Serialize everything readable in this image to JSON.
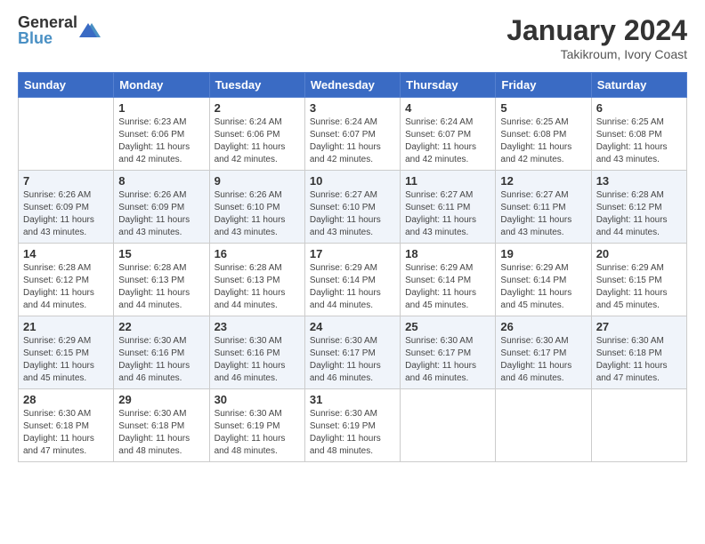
{
  "logo": {
    "general": "General",
    "blue": "Blue"
  },
  "header": {
    "month": "January 2024",
    "location": "Takikroum, Ivory Coast"
  },
  "days_of_week": [
    "Sunday",
    "Monday",
    "Tuesday",
    "Wednesday",
    "Thursday",
    "Friday",
    "Saturday"
  ],
  "weeks": [
    [
      {
        "day": "",
        "info": ""
      },
      {
        "day": "1",
        "info": "Sunrise: 6:23 AM\nSunset: 6:06 PM\nDaylight: 11 hours and 42 minutes."
      },
      {
        "day": "2",
        "info": "Sunrise: 6:24 AM\nSunset: 6:06 PM\nDaylight: 11 hours and 42 minutes."
      },
      {
        "day": "3",
        "info": "Sunrise: 6:24 AM\nSunset: 6:07 PM\nDaylight: 11 hours and 42 minutes."
      },
      {
        "day": "4",
        "info": "Sunrise: 6:24 AM\nSunset: 6:07 PM\nDaylight: 11 hours and 42 minutes."
      },
      {
        "day": "5",
        "info": "Sunrise: 6:25 AM\nSunset: 6:08 PM\nDaylight: 11 hours and 42 minutes."
      },
      {
        "day": "6",
        "info": "Sunrise: 6:25 AM\nSunset: 6:08 PM\nDaylight: 11 hours and 43 minutes."
      }
    ],
    [
      {
        "day": "7",
        "info": "Sunrise: 6:26 AM\nSunset: 6:09 PM\nDaylight: 11 hours and 43 minutes."
      },
      {
        "day": "8",
        "info": "Sunrise: 6:26 AM\nSunset: 6:09 PM\nDaylight: 11 hours and 43 minutes."
      },
      {
        "day": "9",
        "info": "Sunrise: 6:26 AM\nSunset: 6:10 PM\nDaylight: 11 hours and 43 minutes."
      },
      {
        "day": "10",
        "info": "Sunrise: 6:27 AM\nSunset: 6:10 PM\nDaylight: 11 hours and 43 minutes."
      },
      {
        "day": "11",
        "info": "Sunrise: 6:27 AM\nSunset: 6:11 PM\nDaylight: 11 hours and 43 minutes."
      },
      {
        "day": "12",
        "info": "Sunrise: 6:27 AM\nSunset: 6:11 PM\nDaylight: 11 hours and 43 minutes."
      },
      {
        "day": "13",
        "info": "Sunrise: 6:28 AM\nSunset: 6:12 PM\nDaylight: 11 hours and 44 minutes."
      }
    ],
    [
      {
        "day": "14",
        "info": "Sunrise: 6:28 AM\nSunset: 6:12 PM\nDaylight: 11 hours and 44 minutes."
      },
      {
        "day": "15",
        "info": "Sunrise: 6:28 AM\nSunset: 6:13 PM\nDaylight: 11 hours and 44 minutes."
      },
      {
        "day": "16",
        "info": "Sunrise: 6:28 AM\nSunset: 6:13 PM\nDaylight: 11 hours and 44 minutes."
      },
      {
        "day": "17",
        "info": "Sunrise: 6:29 AM\nSunset: 6:14 PM\nDaylight: 11 hours and 44 minutes."
      },
      {
        "day": "18",
        "info": "Sunrise: 6:29 AM\nSunset: 6:14 PM\nDaylight: 11 hours and 45 minutes."
      },
      {
        "day": "19",
        "info": "Sunrise: 6:29 AM\nSunset: 6:14 PM\nDaylight: 11 hours and 45 minutes."
      },
      {
        "day": "20",
        "info": "Sunrise: 6:29 AM\nSunset: 6:15 PM\nDaylight: 11 hours and 45 minutes."
      }
    ],
    [
      {
        "day": "21",
        "info": "Sunrise: 6:29 AM\nSunset: 6:15 PM\nDaylight: 11 hours and 45 minutes."
      },
      {
        "day": "22",
        "info": "Sunrise: 6:30 AM\nSunset: 6:16 PM\nDaylight: 11 hours and 46 minutes."
      },
      {
        "day": "23",
        "info": "Sunrise: 6:30 AM\nSunset: 6:16 PM\nDaylight: 11 hours and 46 minutes."
      },
      {
        "day": "24",
        "info": "Sunrise: 6:30 AM\nSunset: 6:17 PM\nDaylight: 11 hours and 46 minutes."
      },
      {
        "day": "25",
        "info": "Sunrise: 6:30 AM\nSunset: 6:17 PM\nDaylight: 11 hours and 46 minutes."
      },
      {
        "day": "26",
        "info": "Sunrise: 6:30 AM\nSunset: 6:17 PM\nDaylight: 11 hours and 46 minutes."
      },
      {
        "day": "27",
        "info": "Sunrise: 6:30 AM\nSunset: 6:18 PM\nDaylight: 11 hours and 47 minutes."
      }
    ],
    [
      {
        "day": "28",
        "info": "Sunrise: 6:30 AM\nSunset: 6:18 PM\nDaylight: 11 hours and 47 minutes."
      },
      {
        "day": "29",
        "info": "Sunrise: 6:30 AM\nSunset: 6:18 PM\nDaylight: 11 hours and 48 minutes."
      },
      {
        "day": "30",
        "info": "Sunrise: 6:30 AM\nSunset: 6:19 PM\nDaylight: 11 hours and 48 minutes."
      },
      {
        "day": "31",
        "info": "Sunrise: 6:30 AM\nSunset: 6:19 PM\nDaylight: 11 hours and 48 minutes."
      },
      {
        "day": "",
        "info": ""
      },
      {
        "day": "",
        "info": ""
      },
      {
        "day": "",
        "info": ""
      }
    ]
  ]
}
